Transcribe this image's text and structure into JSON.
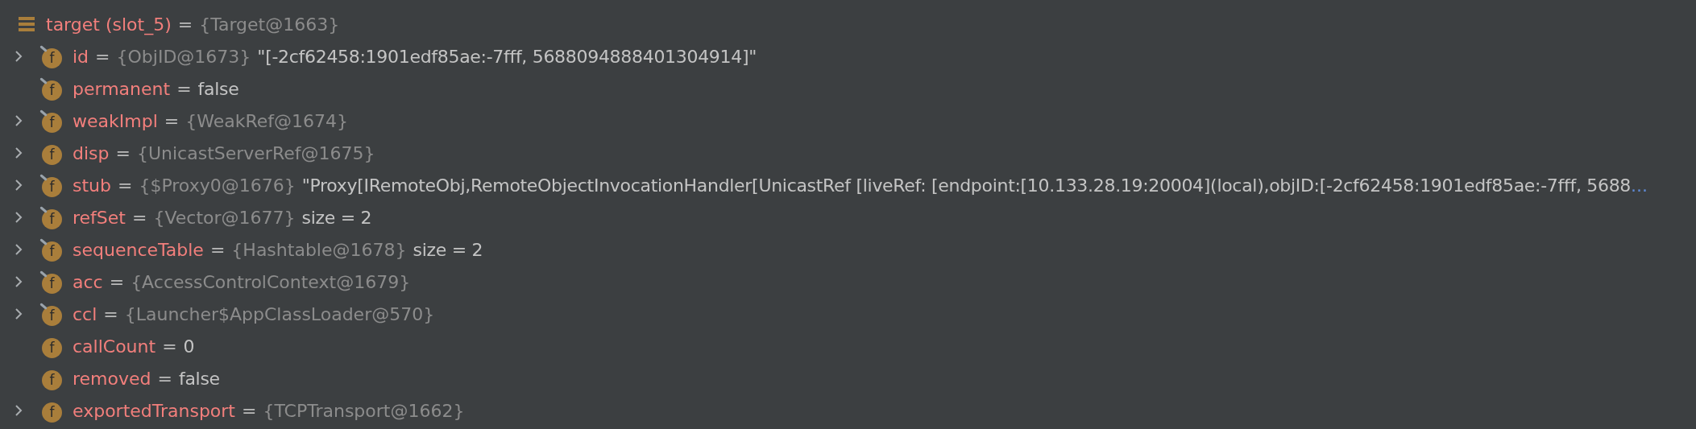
{
  "variable": {
    "name": "target (slot_5)",
    "eq": "=",
    "type": "{Target@1663}",
    "children": [
      {
        "name": "id",
        "type": "{ObjID@1673}",
        "value": "\"[-2cf62458:1901edf85ae:-7fff, 5688094888401304914]\"",
        "expandable": true,
        "final": true,
        "badge": "f"
      },
      {
        "name": "permanent",
        "value": "false",
        "expandable": false,
        "final": true,
        "badge": "f"
      },
      {
        "name": "weakImpl",
        "type": "{WeakRef@1674}",
        "expandable": true,
        "final": true,
        "badge": "f"
      },
      {
        "name": "disp",
        "type": "{UnicastServerRef@1675}",
        "expandable": true,
        "final": false,
        "badge": "f"
      },
      {
        "name": "stub",
        "type": "{$Proxy0@1676}",
        "value": "\"Proxy[IRemoteObj,RemoteObjectInvocationHandler[UnicastRef [liveRef: [endpoint:[10.133.28.19:20004](local),objID:[-2cf62458:1901edf85ae:-7fff, 5688",
        "more": "...",
        "expandable": true,
        "final": true,
        "badge": "f"
      },
      {
        "name": "refSet",
        "type": "{Vector@1677}",
        "value": "size = 2",
        "expandable": true,
        "final": true,
        "badge": "f"
      },
      {
        "name": "sequenceTable",
        "type": "{Hashtable@1678}",
        "value": "size = 2",
        "expandable": true,
        "final": true,
        "badge": "f"
      },
      {
        "name": "acc",
        "type": "{AccessControlContext@1679}",
        "expandable": true,
        "final": true,
        "badge": "f"
      },
      {
        "name": "ccl",
        "type": "{Launcher$AppClassLoader@570}",
        "expandable": true,
        "final": true,
        "badge": "f"
      },
      {
        "name": "callCount",
        "value": "0",
        "expandable": false,
        "final": false,
        "badge": "f"
      },
      {
        "name": "removed",
        "value": "false",
        "expandable": false,
        "final": false,
        "badge": "f"
      },
      {
        "name": "exportedTransport",
        "type": "{TCPTransport@1662}",
        "expandable": true,
        "final": false,
        "badge": "f"
      }
    ]
  }
}
